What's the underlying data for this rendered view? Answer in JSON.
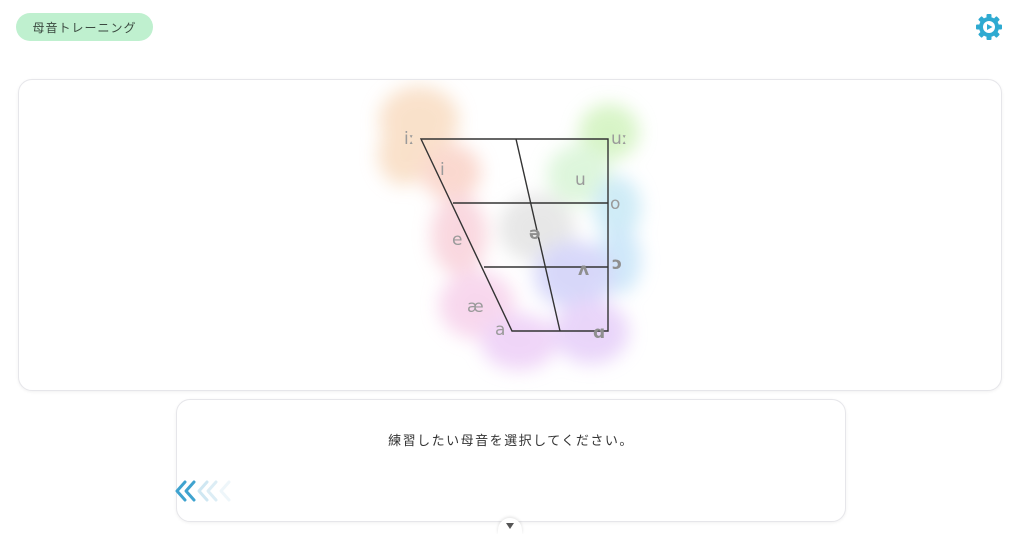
{
  "header": {
    "title": "母音トレーニング",
    "settings_icon": "gear-icon",
    "accent_color": "#2eaad1"
  },
  "vowel_chart": {
    "vowels": [
      {
        "id": "i-long",
        "symbol": "iː",
        "color": "#f5c9a0"
      },
      {
        "id": "i",
        "symbol": "i",
        "color": "#f7b9a8"
      },
      {
        "id": "u-long",
        "symbol": "uː",
        "color": "#b8ec9a"
      },
      {
        "id": "u",
        "symbol": "u",
        "color": "#c3efc0"
      },
      {
        "id": "o",
        "symbol": "o",
        "color": "#a8dcf0"
      },
      {
        "id": "schwa",
        "symbol": "ə",
        "color": "#d4d4d4"
      },
      {
        "id": "e",
        "symbol": "e",
        "color": "#f5b8c6"
      },
      {
        "id": "open-o",
        "symbol": "ɔ",
        "color": "#a8d6f5"
      },
      {
        "id": "wedge",
        "symbol": "ʌ",
        "color": "#b7b8f5"
      },
      {
        "id": "ae",
        "symbol": "æ",
        "color": "#f2b8e0"
      },
      {
        "id": "a",
        "symbol": "a",
        "color": "#e3b4f2"
      },
      {
        "id": "script-a",
        "symbol": "ɑ",
        "color": "#d8b4f5"
      }
    ]
  },
  "message": {
    "text": "練習したい母音を選択してください。"
  },
  "navigation": {
    "back_icon": "double-chevron-left-icon",
    "scroll_down_icon": "chevron-down-icon"
  }
}
